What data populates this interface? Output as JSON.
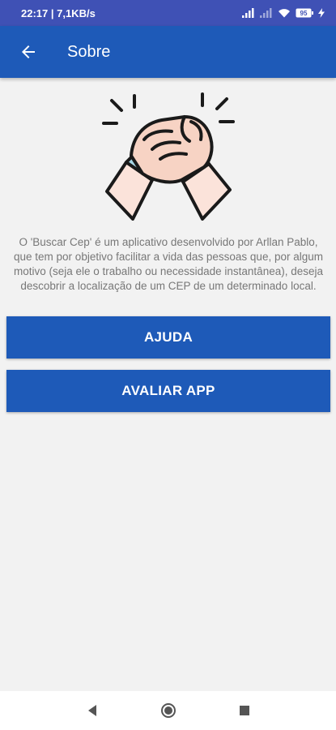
{
  "status_bar": {
    "time_speed": "22:17 | 7,1KB/s",
    "battery": "95",
    "icons": [
      "signal-icon",
      "signal-icon",
      "wifi-icon",
      "battery-icon",
      "charging-icon"
    ]
  },
  "app_bar": {
    "title": "Sobre",
    "back_icon": "arrow-left-icon",
    "color": "#1e5ab8"
  },
  "illustration": {
    "icon": "handshake-arm-wrestling-icon"
  },
  "about": {
    "text": "O 'Buscar Cep' é um aplicativo desenvolvido por Arllan Pablo, que tem por objetivo facilitar a vida das pessoas que, por algum motivo (seja ele o trabalho ou necessidade instantânea), deseja descobrir a localização de um CEP de um determinado local."
  },
  "buttons": {
    "help_label": "AJUDA",
    "rate_label": "AVALIAR APP",
    "color": "#1e5ab8"
  },
  "nav_bar": {
    "icons": [
      "back-triangle-icon",
      "home-circle-icon",
      "recents-square-icon"
    ]
  }
}
